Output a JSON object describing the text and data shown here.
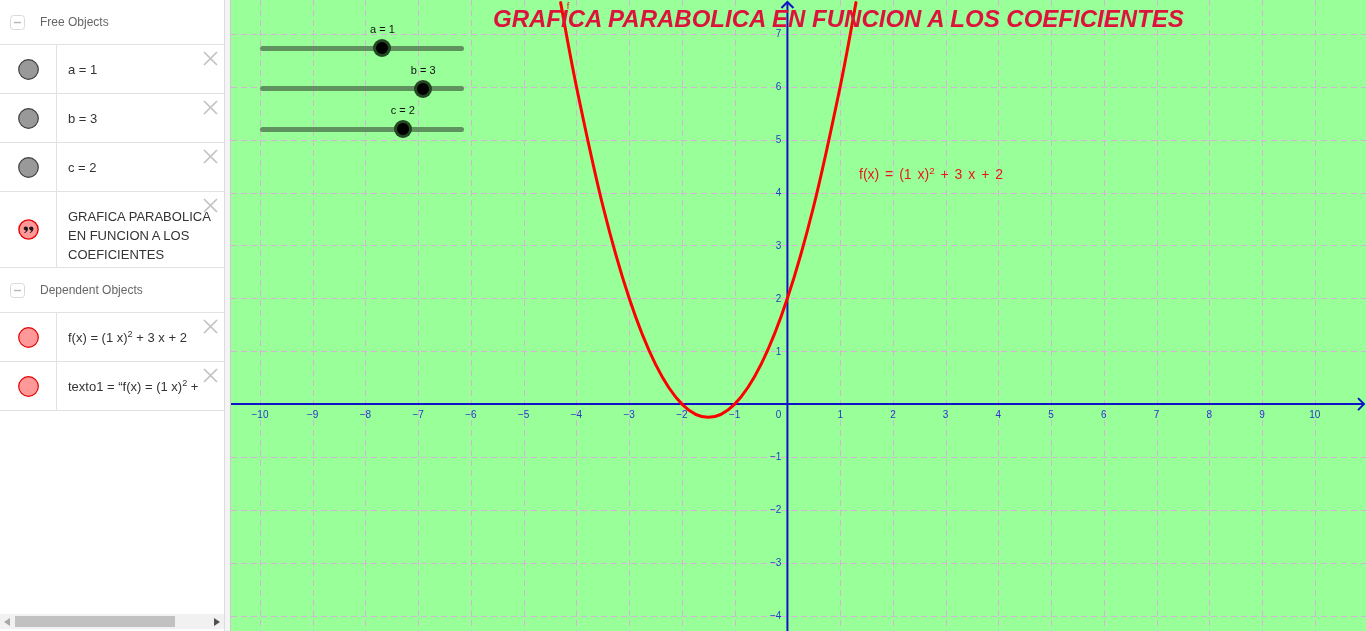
{
  "algebra_view": {
    "groups": [
      {
        "label": "Free Objects",
        "expanded": true,
        "items": [
          {
            "kind": "plain",
            "text": "a = 1",
            "color": "#999999",
            "visible": true
          },
          {
            "kind": "plain",
            "text": "b = 3",
            "color": "#999999",
            "visible": true
          },
          {
            "kind": "plain",
            "text": "c = 2",
            "color": "#999999",
            "visible": true
          },
          {
            "kind": "quote",
            "text": "GRAFICA PARABOLICA EN FUNCION A LOS COEFICIENTES",
            "color": "#ff9999",
            "visible": true
          }
        ]
      },
      {
        "label": "Dependent Objects",
        "expanded": true,
        "items": [
          {
            "kind": "plain",
            "text": "f(x) = (1 x)$^{2}$ + 3 x + 2",
            "color": "#ff9999",
            "visible": true
          },
          {
            "kind": "plain",
            "text": "texto1 = “f(x) = (1 x)$^{2}$ +",
            "color": "#ff9999",
            "visible": true
          }
        ]
      }
    ]
  },
  "graphics_view": {
    "sliders": [
      {
        "label": "a = 1",
        "level": 0.6
      },
      {
        "label": "b = 3",
        "level": 0.8
      },
      {
        "label": "c = 2",
        "level": 0.7
      }
    ],
    "texts": [
      {
        "kind": "title",
        "text": "GRAFICA PARABOLICA EN FUNCION A LOS COEFICIENTES"
      },
      {
        "kind": "formula",
        "text": "f(x) = (1 x)$^{2}$ + 3 x + 2"
      }
    ],
    "origin_label": "0",
    "chart_data": {
      "type": "line",
      "grid": true,
      "x": [
        -4.3,
        -4,
        -3.5,
        -3,
        -2.5,
        -2,
        -1.5,
        -1,
        -0.5,
        0,
        0.5,
        1,
        1.3
      ],
      "series": [
        {
          "name": "f",
          "color": "#ff0000",
          "values": [
            7.59,
            6,
            3.75,
            2,
            0.75,
            0,
            -0.25,
            0,
            0.75,
            2,
            3.75,
            6,
            7.59
          ]
        }
      ],
      "xlim": [
        -10.55,
        10.97
      ],
      "ylim": [
        -4.29,
        7.64
      ],
      "xticks": [
        {
          "value": -10,
          "label": "−10"
        },
        {
          "value": -9,
          "label": "−9"
        },
        {
          "value": -8,
          "label": "−8"
        },
        {
          "value": -7,
          "label": "−7"
        },
        {
          "value": -6,
          "label": "−6"
        },
        {
          "value": -5,
          "label": "−5"
        },
        {
          "value": -4,
          "label": "−4"
        },
        {
          "value": -3,
          "label": "−3"
        },
        {
          "value": -2,
          "label": "−2"
        },
        {
          "value": -1,
          "label": "−1"
        },
        1,
        2,
        3,
        4,
        5,
        6,
        7,
        8,
        9,
        10
      ],
      "yticks": [
        {
          "value": -4,
          "label": "−4"
        },
        {
          "value": -3,
          "label": "−3"
        },
        {
          "value": -2,
          "label": "−2"
        },
        {
          "value": -1,
          "label": "−1"
        },
        1,
        2,
        3,
        4,
        5,
        6,
        7
      ]
    }
  }
}
